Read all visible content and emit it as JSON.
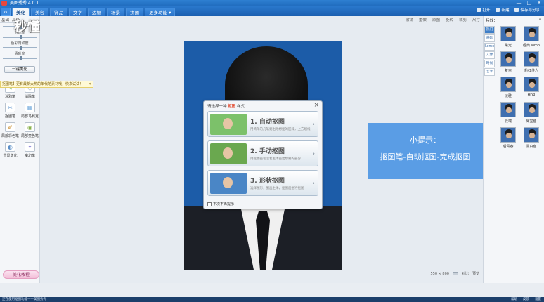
{
  "titlebar": {
    "title": "美图秀秀 4.0.1",
    "controls": [
      "—",
      "□",
      "✕"
    ]
  },
  "menu": {
    "home_icon": "⌂",
    "tabs": [
      "美化",
      "美容",
      "饰品",
      "文字",
      "边框",
      "场景",
      "拼图",
      "更多功能 ▾"
    ]
  },
  "top_right": {
    "open": "打开",
    "new": "新建",
    "save": "保存与分享"
  },
  "watermark": "秒懂视频",
  "left": {
    "tabs": [
      "基础",
      "高级"
    ],
    "sliders": [
      "对比度",
      "色彩饱和度",
      "清晰度"
    ],
    "oneclick": "一键美化",
    "tools": [
      {
        "label": "涂鸦笔",
        "icon": "✎",
        "color": "#6aa84f"
      },
      {
        "label": "消除笔",
        "icon": "◇",
        "color": "#9aa6b3"
      },
      {
        "label": "抠图笔",
        "icon": "✂",
        "color": "#4a86c6"
      },
      {
        "label": "局部马赛克",
        "icon": "▦",
        "color": "#6fa8dc"
      },
      {
        "label": "局部彩色笔",
        "icon": "✐",
        "color": "#c27c0e"
      },
      {
        "label": "局部变色笔",
        "icon": "◉",
        "color": "#8ab34f"
      },
      {
        "label": "背景虚化",
        "icon": "◐",
        "color": "#5b8fc8"
      },
      {
        "label": "魔幻笔",
        "icon": "✦",
        "color": "#7a6fd1"
      }
    ],
    "bottom_button": "美化教程"
  },
  "tip_bar": {
    "text": "抠图笔】更有最新大热的年代范素材哦，快来试试！",
    "close": "✕"
  },
  "canvas": {
    "beauty_label": "放大",
    "toolbar": [
      "撤销",
      "重做",
      "原图",
      "旋转",
      "裁剪",
      "尺寸"
    ],
    "status": [
      "550 × 800",
      "对比",
      "预览"
    ]
  },
  "dialog": {
    "title_prefix": "请选择一种",
    "title_highlight": "抠图",
    "title_suffix": "样式",
    "options": [
      {
        "title": "1. 自动抠图",
        "desc": "用简单的几笔划出你想抠的区域，上方划线",
        "thumb_bg": "#7cc16a"
      },
      {
        "title": "2. 手动抠图",
        "desc": "用抠图画笔沿着主体画出想要的部分",
        "thumb_bg": "#6aa84f"
      },
      {
        "title": "3. 形状抠图",
        "desc": "选择图形，圈画主体，抠图后进行抠图",
        "thumb_bg": "#4a86c6"
      }
    ],
    "footer": "下次不再提示"
  },
  "hint": {
    "line1": "小提示：",
    "line2": "抠图笔-自动抠图-完成抠图"
  },
  "right": {
    "title": "特效：",
    "close": "✕",
    "categories": [
      "热门",
      "基础",
      "Lomo",
      "人像",
      "时尚",
      "艺术"
    ],
    "effects": [
      "柔光",
      "经典 lomo",
      "复古",
      "粉红佳人",
      "淡雅",
      "HDR",
      "云端",
      "阿宝色",
      "后青春",
      "黑白色"
    ]
  },
  "taskbar": {
    "text": "正在使用抠图功能——美图秀秀",
    "right": [
      "帮助",
      "反馈",
      "设置"
    ]
  }
}
